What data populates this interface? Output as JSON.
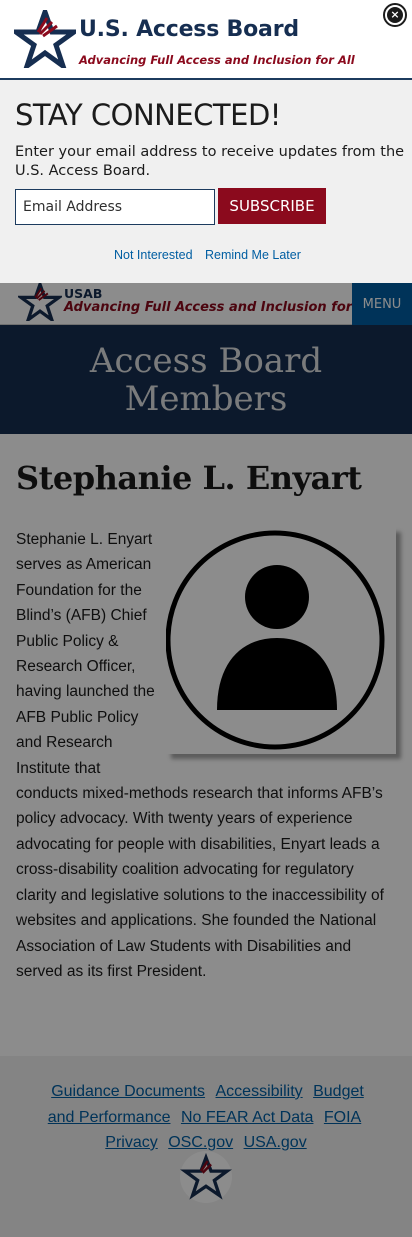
{
  "modal": {
    "logo_title": "U.S. Access Board",
    "logo_tagline": "Advancing Full Access and Inclusion for All",
    "close_label": "×",
    "heading": "STAY CONNECTED!",
    "description": "Enter your email address to receive updates from the U.S. Access Board.",
    "email_placeholder": "Email Address",
    "subscribe_label": "SUBSCRIBE",
    "not_interested_label": "Not Interested",
    "remind_later_label": "Remind Me Later"
  },
  "header": {
    "logo_short": "USAB",
    "logo_tagline": "Advancing Full Access and Inclusion for All",
    "menu_label": "MENU"
  },
  "banner": {
    "title": "Access Board Members"
  },
  "member": {
    "name": "Stephanie L. Enyart",
    "bio": "Stephanie L. Enyart serves as American Foundation for the Blind’s (AFB) Chief Public Policy & Research Officer, having launched the AFB Public Policy and Research Institute that conducts mixed-methods research that informs AFB’s policy advocacy. With twenty years of experience advocating for people with disabilities, Enyart leads a cross-disability coalition advocating for regulatory clarity and legislative solutions to the inaccessibility of websites and applications. She founded the National Association of Law Students with Disabilities and served as its first President."
  },
  "footer": {
    "links": [
      "Guidance Documents",
      "Accessibility",
      "Budget and Performance",
      "No FEAR Act Data",
      "FOIA",
      "Privacy",
      "OSC.gov",
      "USA.gov"
    ]
  },
  "colors": {
    "navy": "#162e51",
    "brand_red": "#8b0a1d",
    "link_blue": "#005ea2",
    "menu_blue": "#005ea2"
  },
  "icons": {
    "logo": "star-logo-icon",
    "close": "close-icon",
    "avatar": "person-placeholder-icon"
  }
}
